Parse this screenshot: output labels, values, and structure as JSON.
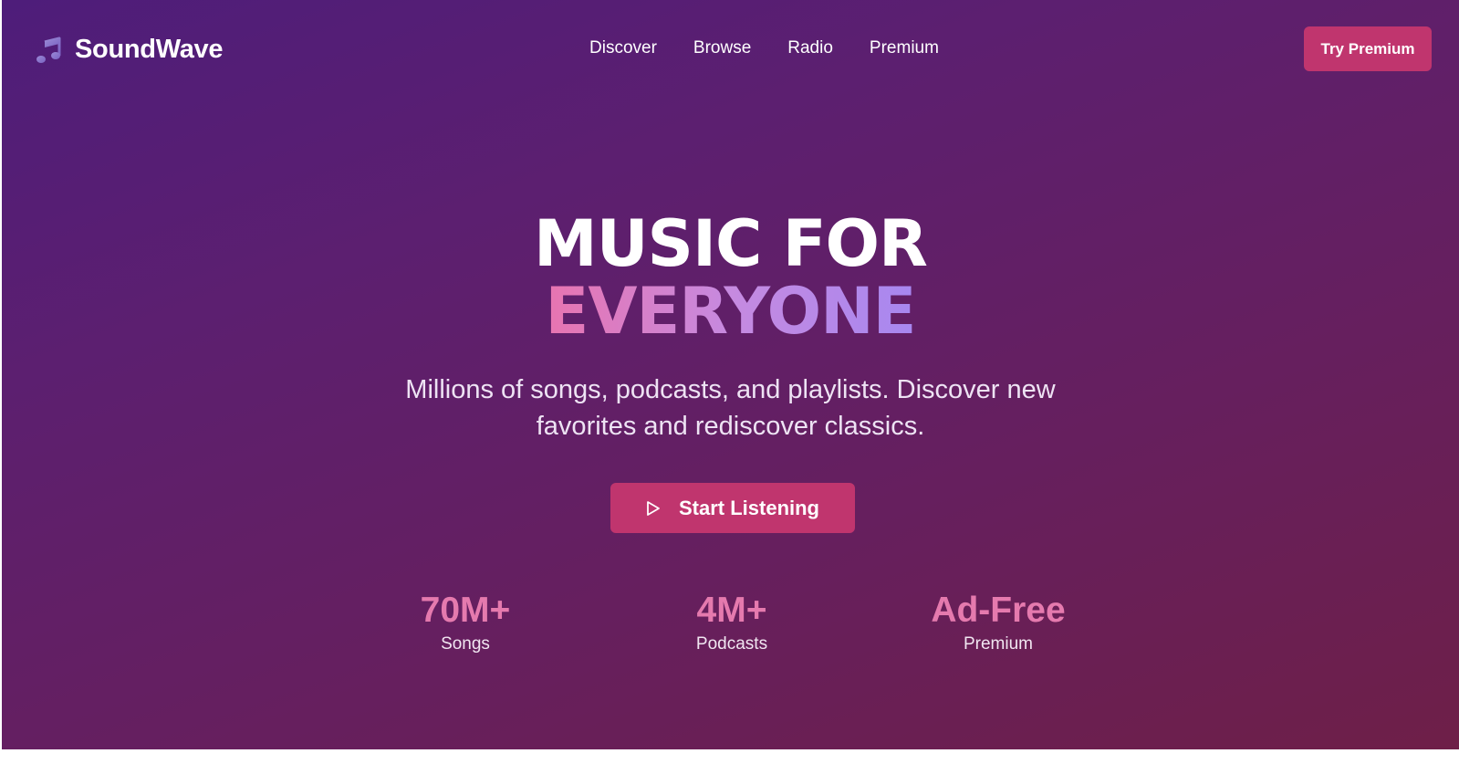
{
  "header": {
    "brand": "SoundWave",
    "logo_icon": "music-note-icon",
    "nav": [
      {
        "label": "Discover"
      },
      {
        "label": "Browse"
      },
      {
        "label": "Radio"
      },
      {
        "label": "Premium"
      }
    ],
    "cta_label": "Try Premium"
  },
  "hero": {
    "title_line1": "MUSIC FOR",
    "title_line2": "EVERYONE",
    "subtitle_line1": "Millions of songs, podcasts, and playlists. Discover new",
    "subtitle_line2": "favorites and rediscover classics.",
    "button_label": "Start Listening",
    "button_icon": "play-icon"
  },
  "stats": [
    {
      "value": "70M+",
      "label": "Songs"
    },
    {
      "value": "4M+",
      "label": "Podcasts"
    },
    {
      "value": "Ad-Free",
      "label": "Premium"
    }
  ],
  "colors": {
    "background_start": "#4e1d7a",
    "background_end": "#6e1f48",
    "accent": "#c0356e",
    "stat_value": "#e57aae",
    "title_gradient_start": "#e874b0",
    "title_gradient_end": "#a787f0"
  }
}
